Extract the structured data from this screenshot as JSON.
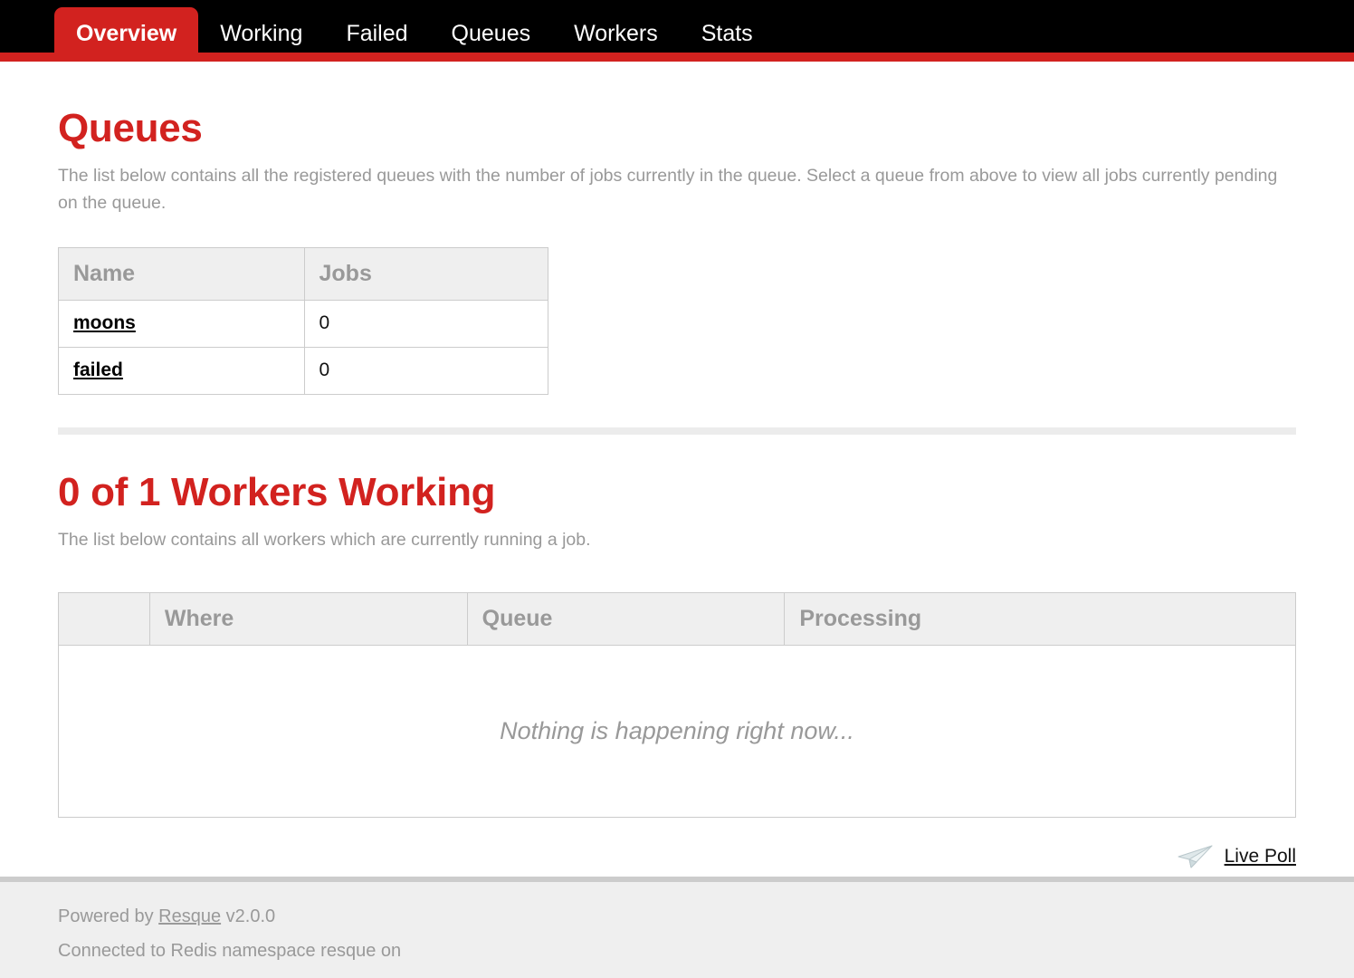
{
  "nav": {
    "items": [
      {
        "label": "Overview",
        "active": true
      },
      {
        "label": "Working",
        "active": false
      },
      {
        "label": "Failed",
        "active": false
      },
      {
        "label": "Queues",
        "active": false
      },
      {
        "label": "Workers",
        "active": false
      },
      {
        "label": "Stats",
        "active": false
      }
    ],
    "active_color": "#d2221f",
    "bar_color": "#000000"
  },
  "queues_section": {
    "title": "Queues",
    "description": "The list below contains all the registered queues with the number of jobs currently in the queue. Select a queue from above to view all jobs currently pending on the queue.",
    "columns": [
      "Name",
      "Jobs"
    ],
    "rows": [
      {
        "name": "moons",
        "jobs": "0"
      },
      {
        "name": "failed",
        "jobs": "0"
      }
    ]
  },
  "workers_section": {
    "title": "0 of 1 Workers Working",
    "description": "The list below contains all workers which are currently running a job.",
    "columns": [
      "",
      "Where",
      "Queue",
      "Processing"
    ],
    "empty_message": "Nothing is happening right now...",
    "rows": []
  },
  "live_poll": {
    "label": "Live Poll",
    "icon": "paper-plane-icon"
  },
  "footer": {
    "powered_prefix": "Powered by ",
    "powered_link": "Resque",
    "powered_version": " v2.0.0",
    "connection": "Connected to Redis namespace resque on"
  },
  "colors": {
    "brand_red": "#d2221f",
    "muted_text": "#999999",
    "table_header_bg": "#efefef",
    "border": "#cccccc"
  }
}
